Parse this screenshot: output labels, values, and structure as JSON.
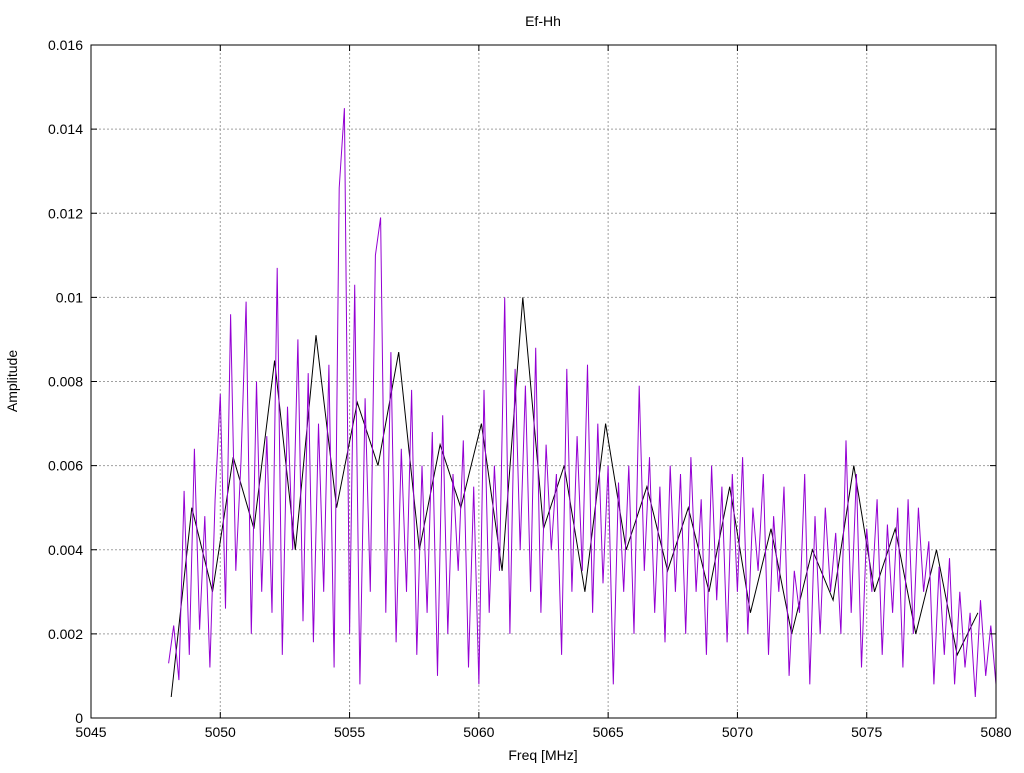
{
  "chart_data": {
    "type": "line",
    "title": "Ef-Hh",
    "xlabel": "Freq [MHz]",
    "ylabel": "Amplitude",
    "xlim": [
      5045,
      5080
    ],
    "ylim": [
      0,
      0.016
    ],
    "xticks": [
      5045,
      5050,
      5055,
      5060,
      5065,
      5070,
      5075,
      5080
    ],
    "xtick_labels": [
      "5045",
      "5050",
      "5055",
      "5060",
      "5065",
      "5070",
      "5075",
      "5080"
    ],
    "yticks": [
      0,
      0.002,
      0.004,
      0.006,
      0.008,
      0.01,
      0.012,
      0.014,
      0.016
    ],
    "ytick_labels": [
      "0",
      "0.002",
      "0.004",
      "0.006",
      "0.008",
      "0.01",
      "0.012",
      "0.014",
      "0.016"
    ],
    "grid": true,
    "series": [
      {
        "name": "black",
        "color": "#000000",
        "x_start": 5048.1,
        "x_step": 0.8,
        "values": [
          0.0005,
          0.005,
          0.003,
          0.0062,
          0.0045,
          0.0085,
          0.004,
          0.0091,
          0.005,
          0.0075,
          0.006,
          0.0087,
          0.004,
          0.0065,
          0.005,
          0.007,
          0.0035,
          0.01,
          0.0045,
          0.006,
          0.003,
          0.007,
          0.004,
          0.0055,
          0.0035,
          0.005,
          0.003,
          0.0055,
          0.0025,
          0.0045,
          0.002,
          0.004,
          0.0028,
          0.006,
          0.003,
          0.0045,
          0.002,
          0.004,
          0.0015,
          0.0025
        ]
      },
      {
        "name": "purple",
        "color": "#9400d3",
        "x_start": 5048.0,
        "x_step": 0.2,
        "values": [
          0.0013,
          0.0022,
          0.0009,
          0.0054,
          0.0015,
          0.0064,
          0.0021,
          0.0048,
          0.0012,
          0.0052,
          0.0077,
          0.0026,
          0.0096,
          0.0035,
          0.0061,
          0.0099,
          0.002,
          0.008,
          0.003,
          0.0067,
          0.0025,
          0.0107,
          0.0015,
          0.0074,
          0.004,
          0.009,
          0.0023,
          0.0082,
          0.0018,
          0.007,
          0.003,
          0.0084,
          0.0012,
          0.0126,
          0.0145,
          0.002,
          0.0103,
          0.0008,
          0.0076,
          0.003,
          0.011,
          0.0119,
          0.0025,
          0.0087,
          0.0018,
          0.0064,
          0.003,
          0.0078,
          0.0015,
          0.006,
          0.0025,
          0.0068,
          0.001,
          0.0072,
          0.002,
          0.0058,
          0.0035,
          0.0066,
          0.0012,
          0.0055,
          0.0008,
          0.0078,
          0.0025,
          0.006,
          0.0035,
          0.01,
          0.002,
          0.0083,
          0.004,
          0.0079,
          0.003,
          0.0088,
          0.0025,
          0.0065,
          0.004,
          0.0058,
          0.0015,
          0.0083,
          0.003,
          0.0067,
          0.0035,
          0.0084,
          0.0025,
          0.007,
          0.0032,
          0.006,
          0.0008,
          0.0056,
          0.003,
          0.006,
          0.002,
          0.0079,
          0.0035,
          0.0062,
          0.0025,
          0.0055,
          0.0018,
          0.006,
          0.003,
          0.0058,
          0.002,
          0.0062,
          0.003,
          0.0052,
          0.0015,
          0.006,
          0.0028,
          0.0055,
          0.0018,
          0.0058,
          0.003,
          0.0062,
          0.002,
          0.005,
          0.0035,
          0.0058,
          0.0015,
          0.0048,
          0.003,
          0.0055,
          0.001,
          0.0035,
          0.0025,
          0.0058,
          0.0008,
          0.0048,
          0.002,
          0.005,
          0.003,
          0.0044,
          0.002,
          0.0066,
          0.0025,
          0.0058,
          0.0012,
          0.0045,
          0.003,
          0.0052,
          0.0015,
          0.0046,
          0.0025,
          0.005,
          0.0012,
          0.0052,
          0.002,
          0.005,
          0.003,
          0.0042,
          0.0008,
          0.0036,
          0.0015,
          0.0038,
          0.0008,
          0.003,
          0.0012,
          0.0025,
          0.0005,
          0.0028,
          0.001,
          0.0022,
          0.0008
        ]
      }
    ]
  }
}
